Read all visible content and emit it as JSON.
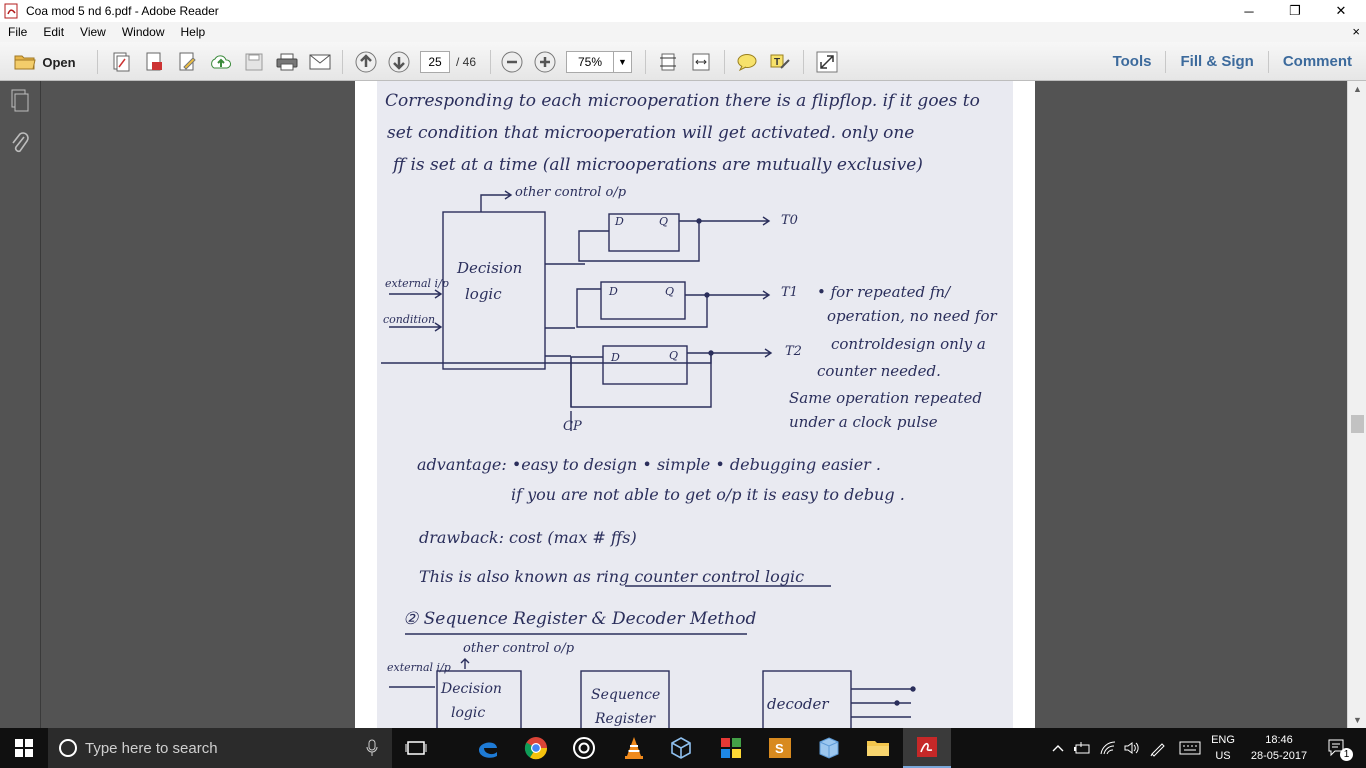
{
  "window": {
    "title": "Coa  mod 5 nd 6.pdf - Adobe Reader",
    "minimize": "─",
    "restore": "❐",
    "close": "✕"
  },
  "menu": {
    "items": [
      "File",
      "Edit",
      "View",
      "Window",
      "Help"
    ],
    "close_doc": "×"
  },
  "toolbar": {
    "open_label": "Open",
    "page_current": "25",
    "page_total": "/ 46",
    "zoom": "75%",
    "tools_label": "Tools",
    "fill_sign_label": "Fill & Sign",
    "comment_label": "Comment"
  },
  "document": {
    "lines": {
      "l1": "Corresponding to each microoperation there is a flipflop. if it goes to",
      "l2": "set condition  that microoperation will get activated.  only one",
      "l3": "ff is set at a time  (all microoperations are mutually exclusive)",
      "other_op1": "other control o/p",
      "decision1": "Decision",
      "logic1": "logic",
      "ext1": "external i/p",
      "cond1": "condition",
      "d": "D",
      "q": "Q",
      "t0": "T0",
      "t1": "T1",
      "t2": "T2",
      "cp": "CP",
      "note1": "• for repeated fn/",
      "note2": "operation,  no need for",
      "note3": "controldesign  only a",
      "note4": "counter needed.",
      "note5": "Same operation repeated",
      "note6": "under a clock pulse",
      "adv1": "advantage: •easy to design  • simple   •  debugging easier .",
      "adv2": "if you are not able to get o/p it is  easy to  debug .",
      "drawback": "drawback: cost (max # ffs)",
      "also": "This is also  known as  ring counter control logic",
      "heading2": "② Sequence  Register & Decoder Method",
      "other_op2": "other control o/p",
      "ext2": "external i/p",
      "decision2": "Decision",
      "logic2": "logic",
      "seq1": "Sequence",
      "seq2": "Register",
      "decoder": "decoder"
    }
  },
  "taskbar": {
    "search_placeholder": "Type here to search",
    "lang1": "ENG",
    "lang2": "US",
    "time": "18:46",
    "date": "28-05-2017",
    "notif_count": "1"
  },
  "colors": {
    "accent_link": "#3c6a9c",
    "nav_bg": "#535353",
    "taskbar_bg": "#101010",
    "ink": "#2b2f5c"
  }
}
